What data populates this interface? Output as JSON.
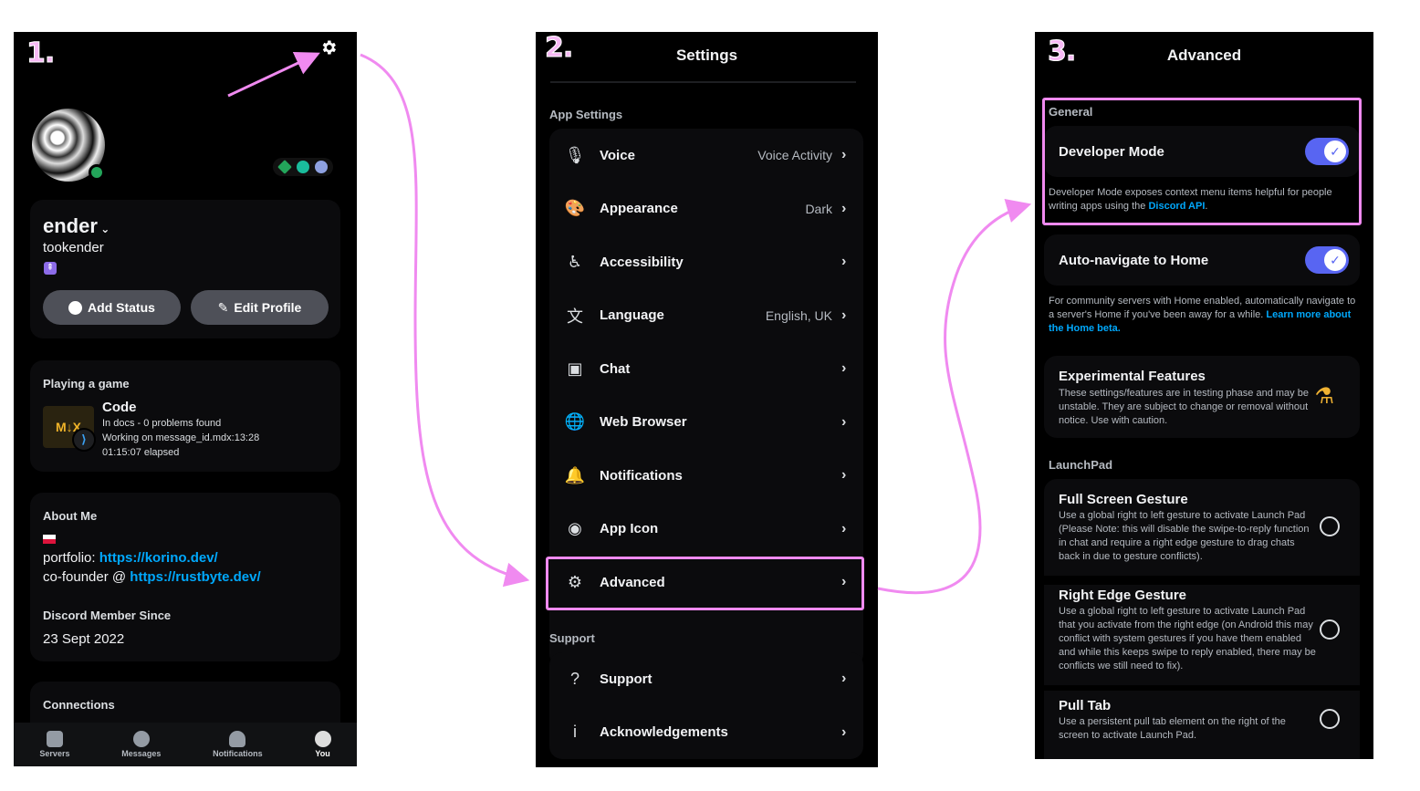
{
  "steps": [
    "1.",
    "2.",
    "3."
  ],
  "profile": {
    "name": "ender",
    "handle": "tookender",
    "add_status": "Add Status",
    "edit_profile": "Edit Profile",
    "playing_label": "Playing a game",
    "game_name": "Code",
    "game_icon_text": "M↓X",
    "game_line1": "In docs - 0 problems found",
    "game_line2": "Working on message_id.mdx:13:28",
    "game_line3": "01:15:07 elapsed",
    "about_label": "About Me",
    "about_line1_prefix": "portfolio: ",
    "about_line1_link": "https://korino.dev/",
    "about_line2_prefix": "co-founder @ ",
    "about_line2_link": "https://rustbyte.dev/",
    "member_since_label": "Discord Member Since",
    "member_since": "23 Sept 2022",
    "connections_label": "Connections",
    "nav": [
      "Servers",
      "Messages",
      "Notifications",
      "You"
    ]
  },
  "settings": {
    "title": "Settings",
    "app_settings_label": "App Settings",
    "items": [
      {
        "label": "Voice",
        "value": "Voice Activity",
        "icon": "microphone-icon"
      },
      {
        "label": "Appearance",
        "value": "Dark",
        "icon": "palette-icon"
      },
      {
        "label": "Accessibility",
        "value": "",
        "icon": "accessibility-icon"
      },
      {
        "label": "Language",
        "value": "English, UK",
        "icon": "translate-icon"
      },
      {
        "label": "Chat",
        "value": "",
        "icon": "chat-image-icon"
      },
      {
        "label": "Web Browser",
        "value": "",
        "icon": "globe-icon"
      },
      {
        "label": "Notifications",
        "value": "",
        "icon": "bell-icon"
      },
      {
        "label": "App Icon",
        "value": "",
        "icon": "discord-icon"
      },
      {
        "label": "Advanced",
        "value": "",
        "icon": "gear-icon"
      }
    ],
    "support_label": "Support",
    "support_items": [
      {
        "label": "Support",
        "icon": "question-icon"
      },
      {
        "label": "Acknowledgements",
        "icon": "info-icon"
      }
    ]
  },
  "advanced": {
    "title": "Advanced",
    "general_label": "General",
    "developer_mode": "Developer Mode",
    "developer_desc_prefix": "Developer Mode exposes context menu items helpful for people writing apps using the ",
    "developer_desc_link": "Discord API",
    "developer_desc_suffix": ".",
    "auto_nav": "Auto-navigate to Home",
    "auto_nav_desc_prefix": "For community servers with Home enabled, automatically navigate to a server's Home if you've been away for a while. ",
    "auto_nav_desc_link": "Learn more about the Home beta.",
    "experimental": "Experimental Features",
    "experimental_desc": "These settings/features are in testing phase and may be unstable. They are subject to change or removal without notice. Use with caution.",
    "launchpad_label": "LaunchPad",
    "full_screen": "Full Screen Gesture",
    "full_screen_desc": "Use a global right to left gesture to activate Launch Pad (Please Note: this will disable the swipe-to-reply function in chat and require a right edge gesture to drag chats back in due to gesture conflicts).",
    "right_edge": "Right Edge Gesture",
    "right_edge_desc": "Use a global right to left gesture to activate Launch Pad that you activate from the right edge (on Android this may conflict with system gestures if you have them enabled and while this keeps swipe to reply enabled, there may be conflicts we still need to fix).",
    "pull_tab": "Pull Tab",
    "pull_tab_desc": "Use a persistent pull tab element on the right of the screen to activate Launch Pad."
  },
  "colors": {
    "highlight": "#f08af0",
    "accent": "#5865f2",
    "link": "#00a8fc",
    "online": "#23a55a"
  }
}
